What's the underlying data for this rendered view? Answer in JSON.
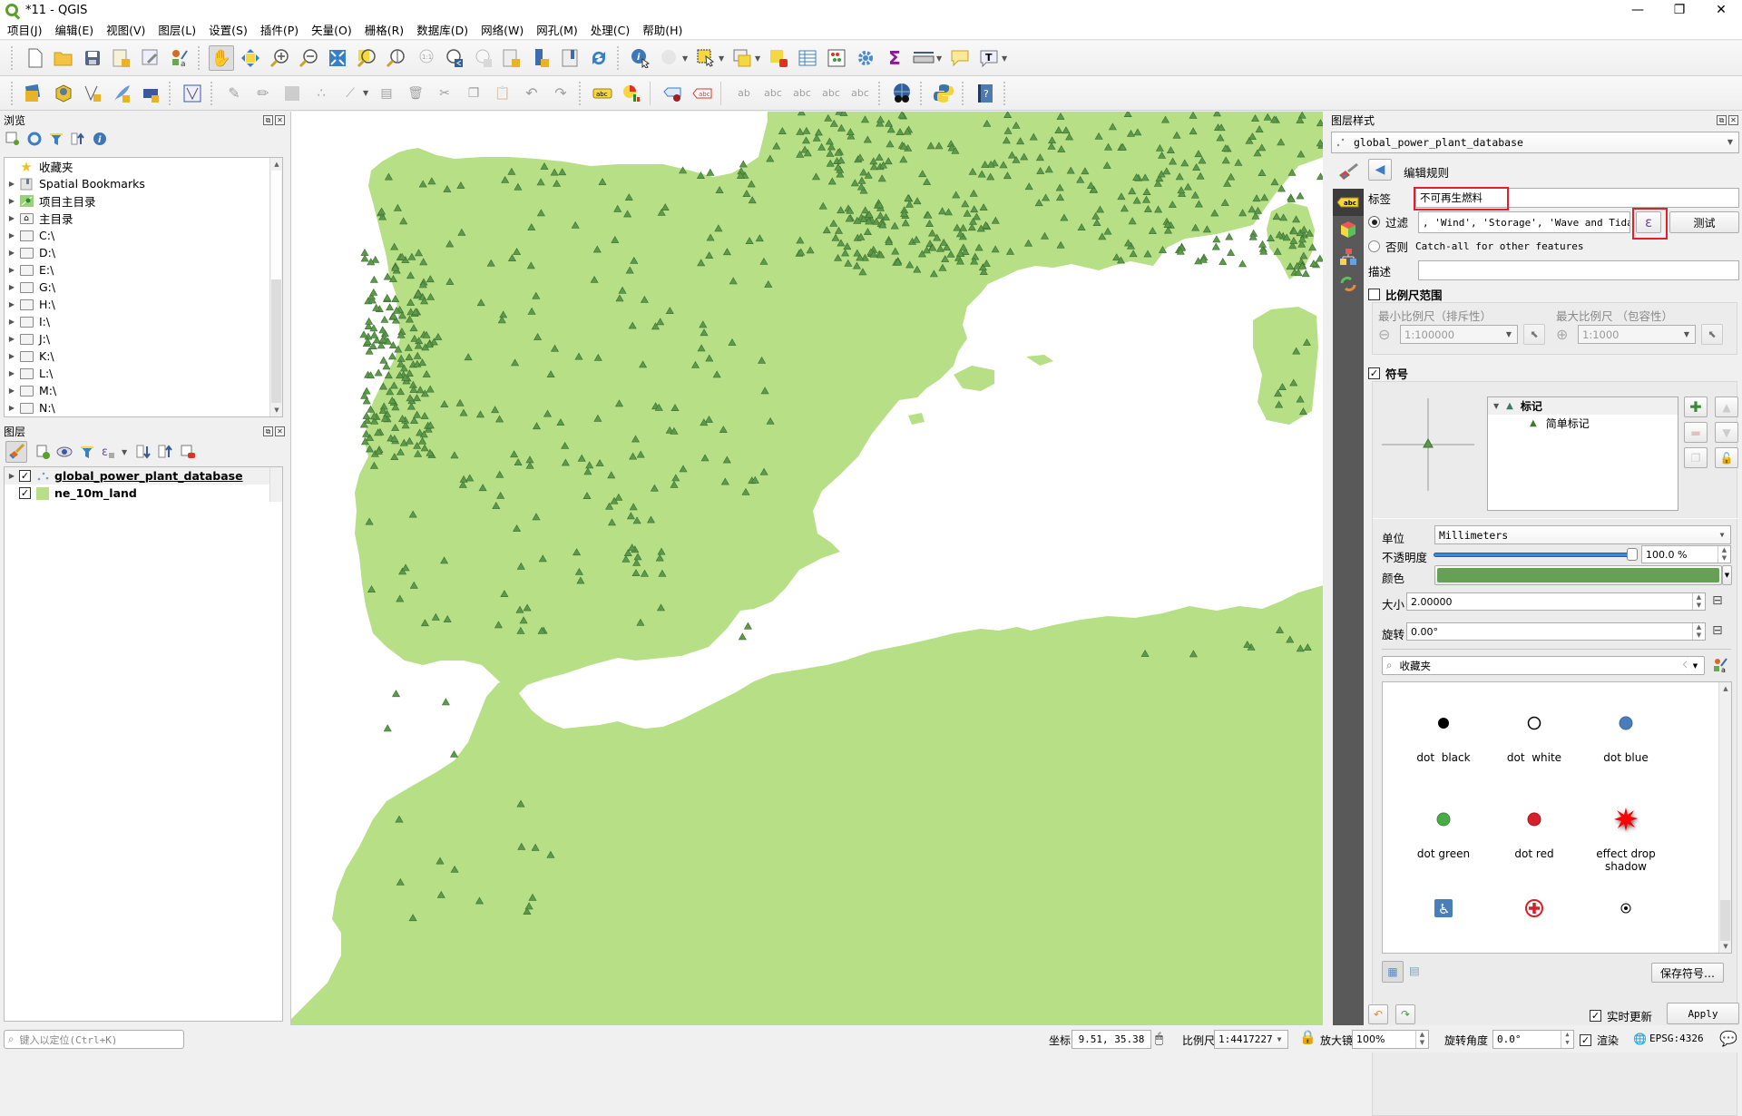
{
  "window": {
    "title": "*11 - QGIS",
    "minimize": "—",
    "maximize": "❐",
    "close": "✕"
  },
  "menu": [
    "项目(J)",
    "编辑(E)",
    "视图(V)",
    "图层(L)",
    "设置(S)",
    "插件(P)",
    "矢量(O)",
    "栅格(R)",
    "数据库(D)",
    "网络(W)",
    "网孔(M)",
    "处理(C)",
    "帮助(H)"
  ],
  "browser": {
    "title": "浏览",
    "items": [
      {
        "label": "收藏夹",
        "icon": "star-icon",
        "expandable": false
      },
      {
        "label": "Spatial Bookmarks",
        "icon": "bookmark-icon",
        "expandable": true
      },
      {
        "label": "项目主目录",
        "icon": "project-home-icon",
        "expandable": true
      },
      {
        "label": "主目录",
        "icon": "home-folder-icon",
        "expandable": true
      },
      {
        "label": "C:\\",
        "icon": "folder-icon",
        "expandable": true
      },
      {
        "label": "D:\\",
        "icon": "folder-icon",
        "expandable": true
      },
      {
        "label": "E:\\",
        "icon": "folder-icon",
        "expandable": true
      },
      {
        "label": "G:\\",
        "icon": "folder-icon",
        "expandable": true
      },
      {
        "label": "H:\\",
        "icon": "folder-icon",
        "expandable": true
      },
      {
        "label": "I:\\",
        "icon": "folder-icon",
        "expandable": true
      },
      {
        "label": "J:\\",
        "icon": "folder-icon",
        "expandable": true
      },
      {
        "label": "K:\\",
        "icon": "folder-icon",
        "expandable": true
      },
      {
        "label": "L:\\",
        "icon": "folder-icon",
        "expandable": true
      },
      {
        "label": "M:\\",
        "icon": "folder-icon",
        "expandable": true
      },
      {
        "label": "N:\\",
        "icon": "folder-icon",
        "expandable": true
      }
    ]
  },
  "layers": {
    "title": "图层",
    "items": [
      {
        "name": "global_power_plant_database",
        "checked": true,
        "type": "point",
        "selected": true
      },
      {
        "name": "ne_10m_land",
        "checked": true,
        "type": "polygon",
        "color": "#b7df86"
      }
    ]
  },
  "map": {
    "land_color": "#b7df86",
    "marker_color": "#5a9a49",
    "marker_stroke": "#3f6e33",
    "water_color": "#ffffff"
  },
  "style_panel": {
    "title": "图层样式",
    "layer_select": "global_power_plant_database",
    "rule_header": "编辑规则",
    "label_caption": "标签",
    "label_value": "不可再生燃料",
    "filter_caption": "过滤",
    "filter_value": ", 'Wind', 'Storage', 'Wave and Tidal')",
    "epsilon_button": "ε",
    "test_button": "测试",
    "else_caption": "否则",
    "else_text": "Catch-all for other features",
    "description_caption": "描述",
    "description_value": "",
    "scale_range_caption": "比例尺范围",
    "scale_range_checked": false,
    "min_scale_caption": "最小比例尺（排斥性）",
    "max_scale_caption": "最大比例尺 （包容性）",
    "min_scale_value": "1:100000",
    "max_scale_value": "1:1000",
    "symbol_caption": "符号",
    "symbol_checked": true,
    "symbol_tree": [
      {
        "label": "标记",
        "level": 0
      },
      {
        "label": "简单标记",
        "level": 1
      }
    ],
    "unit_caption": "单位",
    "unit_value": "Millimeters",
    "opacity_caption": "不透明度",
    "opacity_value": "100.0 %",
    "opacity_fraction": 1.0,
    "color_caption": "颜色",
    "color_value": "#65a055",
    "size_caption": "大小",
    "size_value": "2.00000",
    "rotation_caption": "旋转",
    "rotation_value": "0.00°",
    "library_search": "收藏夹",
    "symbols": [
      {
        "label": "dot  black",
        "icon": "dot-black-icon"
      },
      {
        "label": "dot  white",
        "icon": "dot-white-icon"
      },
      {
        "label": "dot blue",
        "icon": "dot-blue-icon"
      },
      {
        "label": "dot green",
        "icon": "dot-green-icon"
      },
      {
        "label": "dot red",
        "icon": "dot-red-icon"
      },
      {
        "label": "effect drop shadow",
        "icon": "star-burst-icon"
      },
      {
        "label": "",
        "icon": "accessibility-icon"
      },
      {
        "label": "",
        "icon": "red-cross-icon"
      },
      {
        "label": "",
        "icon": "dot-center-icon"
      }
    ],
    "save_symbol_button": "保存符号…",
    "live_update_caption": "实时更新",
    "live_update_checked": true,
    "apply_button": "Apply"
  },
  "statusbar": {
    "locator_placeholder": "键入以定位(Ctrl+K)",
    "coord_caption": "坐标",
    "coord_value": "9.51, 35.38",
    "scale_caption": "比例尺",
    "scale_value": "1:4417227",
    "magnifier_caption": "放大镜",
    "magnifier_value": "100%",
    "rotation_caption": "旋转角度",
    "rotation_value": "0.0°",
    "render_caption": "渲染",
    "render_checked": true,
    "crs": "EPSG:4326"
  }
}
